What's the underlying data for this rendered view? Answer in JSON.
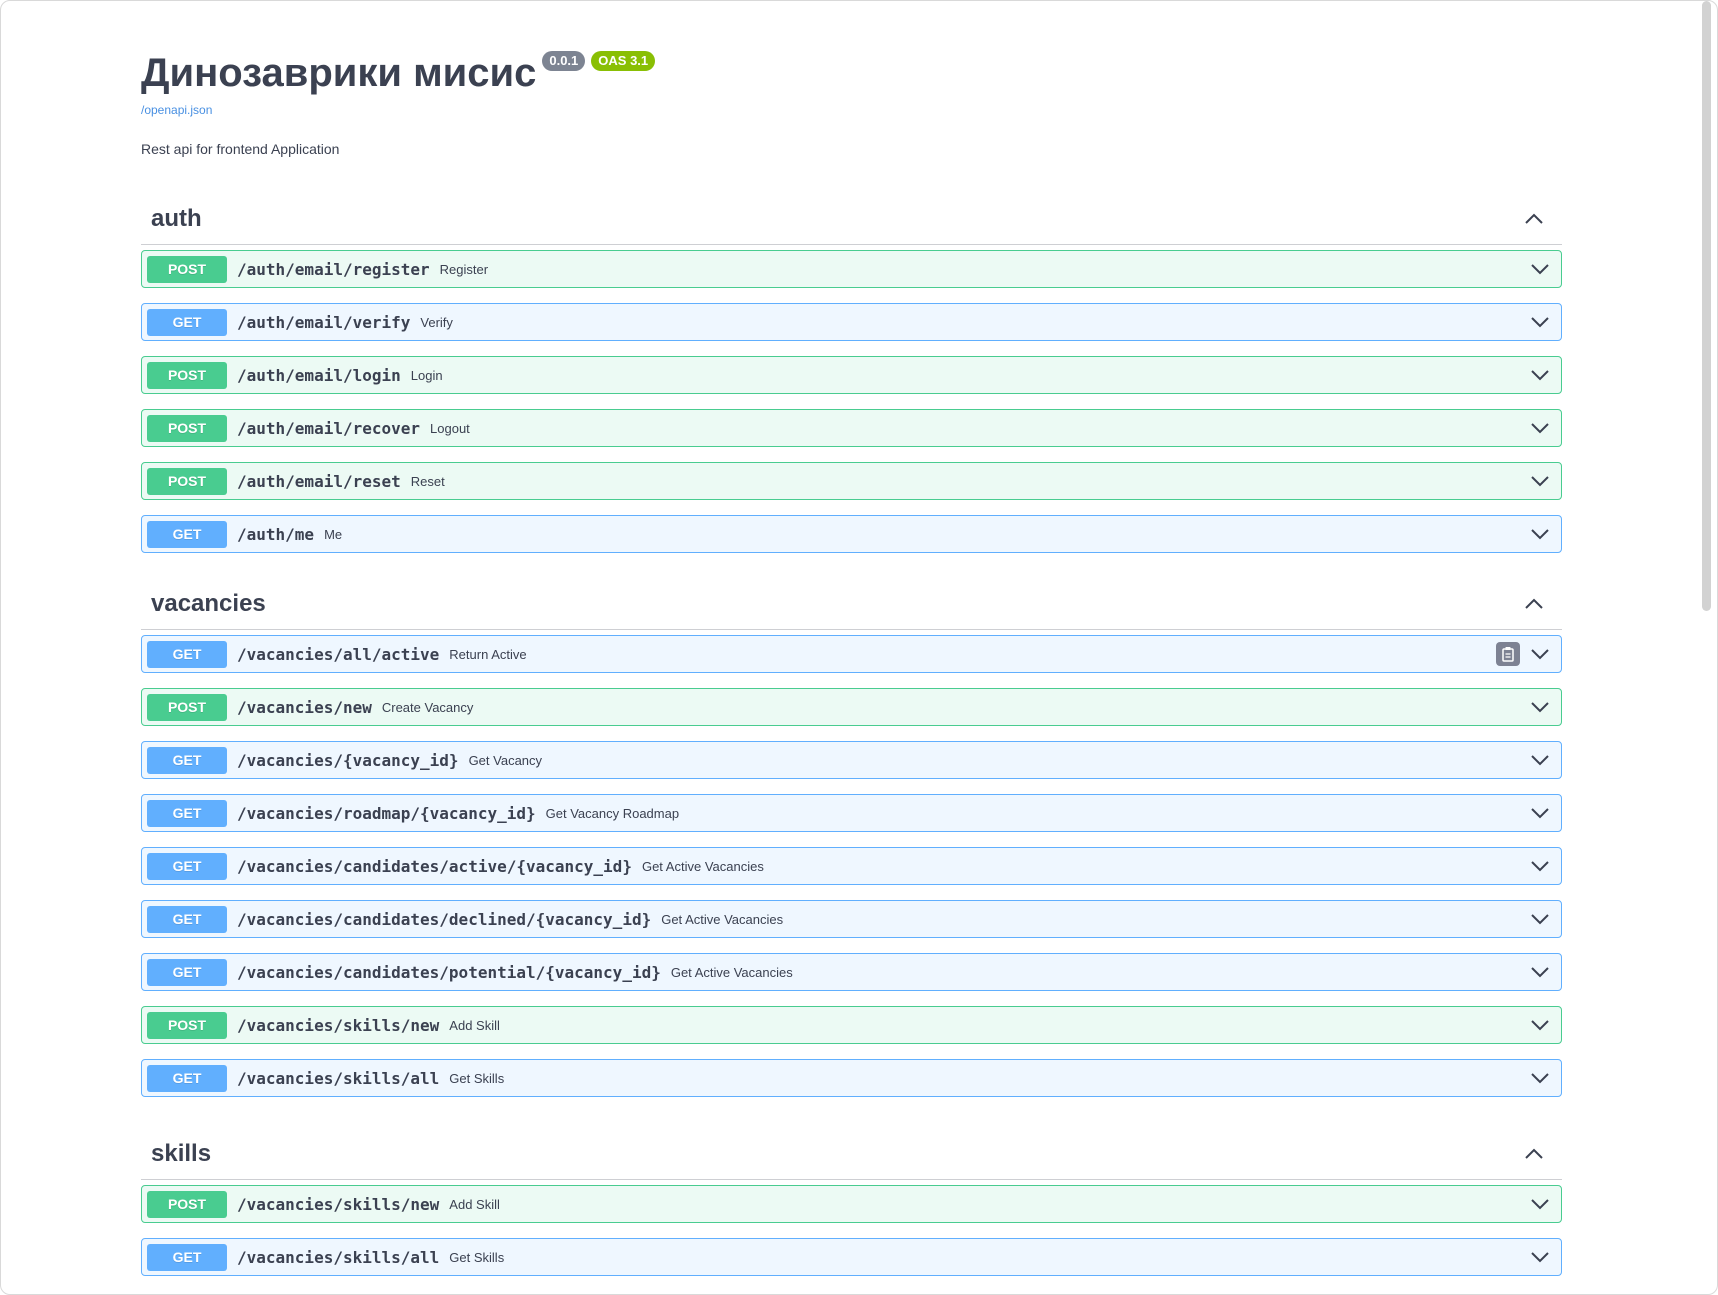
{
  "info": {
    "title": "Динозаврики мисис",
    "version": "0.0.1",
    "oas": "OAS 3.1",
    "spec_link": "/openapi.json",
    "description": "Rest api for frontend Application"
  },
  "colors": {
    "post": "#49cc90",
    "get": "#61affe",
    "text": "#3b4151"
  },
  "tags": [
    {
      "name": "auth",
      "operations": [
        {
          "method": "POST",
          "path": "/auth/email/register",
          "summary": "Register"
        },
        {
          "method": "GET",
          "path": "/auth/email/verify",
          "summary": "Verify"
        },
        {
          "method": "POST",
          "path": "/auth/email/login",
          "summary": "Login"
        },
        {
          "method": "POST",
          "path": "/auth/email/recover",
          "summary": "Logout"
        },
        {
          "method": "POST",
          "path": "/auth/email/reset",
          "summary": "Reset"
        },
        {
          "method": "GET",
          "path": "/auth/me",
          "summary": "Me"
        }
      ]
    },
    {
      "name": "vacancies",
      "operations": [
        {
          "method": "GET",
          "path": "/vacancies/all/active",
          "summary": "Return Active",
          "copy_icon": "clipboard-icon"
        },
        {
          "method": "POST",
          "path": "/vacancies/new",
          "summary": "Create Vacancy"
        },
        {
          "method": "GET",
          "path": "/vacancies/{vacancy_id}",
          "summary": "Get Vacancy"
        },
        {
          "method": "GET",
          "path": "/vacancies/roadmap/{vacancy_id}",
          "summary": "Get Vacancy Roadmap"
        },
        {
          "method": "GET",
          "path": "/vacancies/candidates/active/{vacancy_id}",
          "summary": "Get Active Vacancies"
        },
        {
          "method": "GET",
          "path": "/vacancies/candidates/declined/{vacancy_id}",
          "summary": "Get Active Vacancies"
        },
        {
          "method": "GET",
          "path": "/vacancies/candidates/potential/{vacancy_id}",
          "summary": "Get Active Vacancies"
        },
        {
          "method": "POST",
          "path": "/vacancies/skills/new",
          "summary": "Add Skill"
        },
        {
          "method": "GET",
          "path": "/vacancies/skills/all",
          "summary": "Get Skills"
        }
      ]
    },
    {
      "name": "skills",
      "operations": [
        {
          "method": "POST",
          "path": "/vacancies/skills/new",
          "summary": "Add Skill"
        },
        {
          "method": "GET",
          "path": "/vacancies/skills/all",
          "summary": "Get Skills"
        }
      ]
    }
  ]
}
